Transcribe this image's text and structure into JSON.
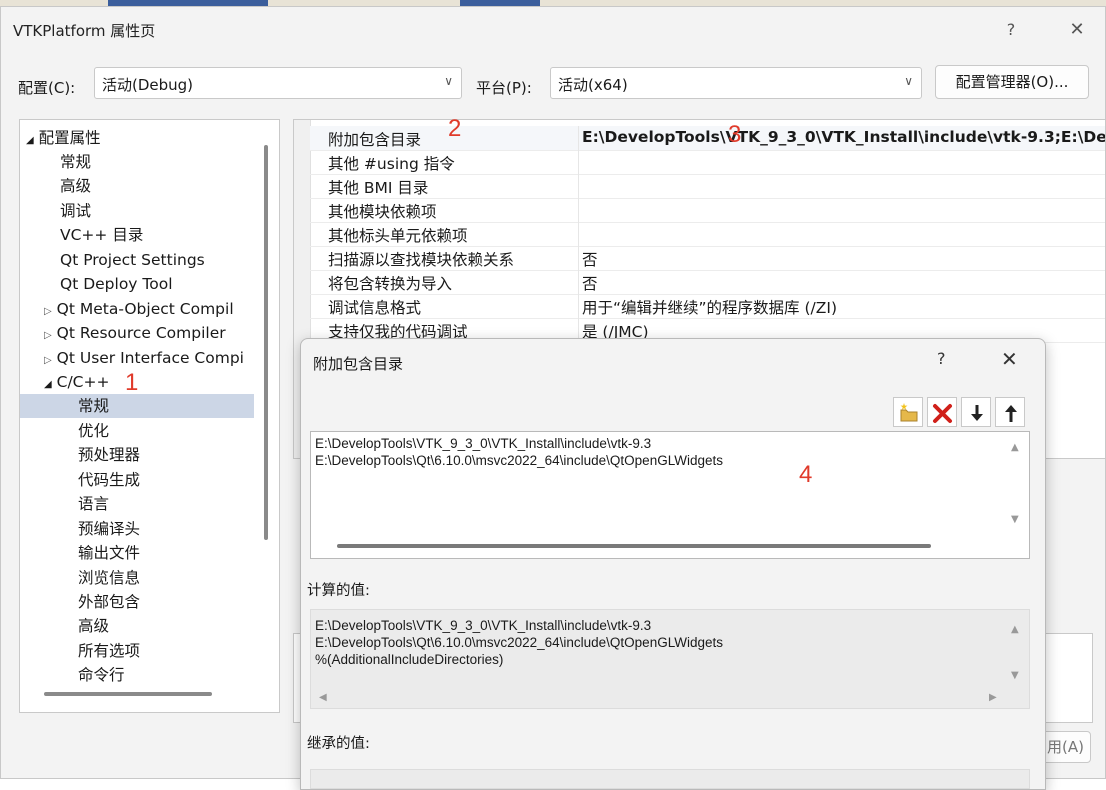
{
  "window": {
    "title": "VTKPlatform 属性页",
    "help_glyph": "?",
    "close_glyph": "✕"
  },
  "config_bar": {
    "config_label": "配置(C):",
    "config_value": "活动(Debug)",
    "platform_label": "平台(P):",
    "platform_value": "活动(x64)",
    "chevron_glyph": "∨",
    "config_manager_label": "配置管理器(O)..."
  },
  "tree": {
    "items": [
      {
        "glyph": "◢",
        "label": "配置属性"
      },
      {
        "glyph": "",
        "label": "常规"
      },
      {
        "glyph": "",
        "label": "高级"
      },
      {
        "glyph": "",
        "label": "调试"
      },
      {
        "glyph": "",
        "label": "VC++ 目录"
      },
      {
        "glyph": "",
        "label": "Qt Project Settings"
      },
      {
        "glyph": "",
        "label": "Qt Deploy Tool"
      },
      {
        "glyph": "▷",
        "label": "Qt Meta-Object Compil"
      },
      {
        "glyph": "▷",
        "label": "Qt Resource Compiler"
      },
      {
        "glyph": "▷",
        "label": "Qt User Interface Compi"
      },
      {
        "glyph": "◢",
        "label": "C/C++"
      },
      {
        "glyph": "",
        "label": "常规"
      },
      {
        "glyph": "",
        "label": "优化"
      },
      {
        "glyph": "",
        "label": "预处理器"
      },
      {
        "glyph": "",
        "label": "代码生成"
      },
      {
        "glyph": "",
        "label": "语言"
      },
      {
        "glyph": "",
        "label": "预编译头"
      },
      {
        "glyph": "",
        "label": "输出文件"
      },
      {
        "glyph": "",
        "label": "浏览信息"
      },
      {
        "glyph": "",
        "label": "外部包含"
      },
      {
        "glyph": "",
        "label": "高级"
      },
      {
        "glyph": "",
        "label": "所有选项"
      },
      {
        "glyph": "",
        "label": "命令行"
      }
    ]
  },
  "grid": {
    "rows": [
      {
        "name": "附加包含目录",
        "value": "E:\\DevelopTools\\VTK_9_3_0\\VTK_Install\\include\\vtk-9.3;E:\\De"
      },
      {
        "name": "其他 #using 指令",
        "value": ""
      },
      {
        "name": "其他 BMI 目录",
        "value": ""
      },
      {
        "name": "其他模块依赖项",
        "value": ""
      },
      {
        "name": "其他标头单元依赖项",
        "value": ""
      },
      {
        "name": "扫描源以查找模块依赖关系",
        "value": "否"
      },
      {
        "name": "将包含转换为导入",
        "value": "否"
      },
      {
        "name": "调试信息格式",
        "value": "用于“编辑并继续”的程序数据库 (/ZI)"
      },
      {
        "name": "支持仅我的代码调试",
        "value": "是 (/JMC)"
      }
    ]
  },
  "annotations": {
    "a1": "1",
    "a2": "2",
    "a3": "3",
    "a4": "4"
  },
  "apply_button": "用(A)",
  "dialog": {
    "title": "附加包含目录",
    "help_glyph": "?",
    "close_glyph": "✕",
    "toolbar": [
      "new-folder-icon",
      "delete-icon",
      "move-down-icon",
      "move-up-icon"
    ],
    "lines": [
      "E:\\DevelopTools\\VTK_9_3_0\\VTK_Install\\include\\vtk-9.3",
      "E:\\DevelopTools\\Qt\\6.10.0\\msvc2022_64\\include\\QtOpenGLWidgets"
    ],
    "computed_label": "计算的值:",
    "computed_lines": [
      "E:\\DevelopTools\\VTK_9_3_0\\VTK_Install\\include\\vtk-9.3",
      "E:\\DevelopTools\\Qt\\6.10.0\\msvc2022_64\\include\\QtOpenGLWidgets",
      "%(AdditionalIncludeDirectories)"
    ],
    "inherited_label": "继承的值:",
    "scroll_up": "▲",
    "scroll_down": "▼",
    "scroll_left": "◀",
    "scroll_right": "▶"
  },
  "colors": {
    "annotation": "#e03a2a",
    "selection": "#ccd6e6",
    "delete_icon": "#d0201a"
  }
}
